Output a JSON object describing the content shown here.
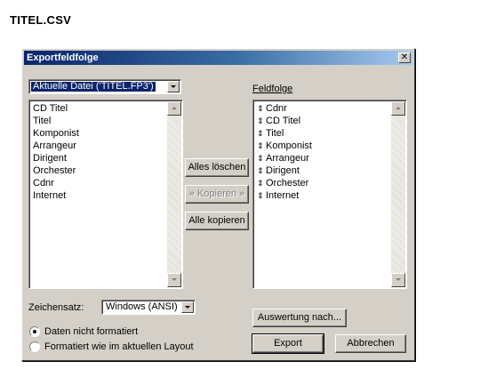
{
  "page": {
    "title": "TITEL.CSV"
  },
  "dialog": {
    "title": "Exportfeldfolge",
    "close_glyph": "✕",
    "source_select": {
      "value": "Aktuelle Datei ('TITEL.FP3')"
    },
    "source_fields": [
      "CD Titel",
      "Titel",
      "Komponist",
      "Arrangeur",
      "Dirigent",
      "Orchester",
      "Cdnr",
      "Internet"
    ],
    "buttons": {
      "clear_all": "Alles löschen",
      "copy": "» Kopieren »",
      "copy_all": "Alle kopieren",
      "evaluation": "Auswertung nach...",
      "export": "Export",
      "cancel": "Abbrechen"
    },
    "field_order": {
      "label": "Feldfolge",
      "move_glyph": "⇕",
      "items": [
        "Cdnr",
        "CD Titel",
        "Titel",
        "Komponist",
        "Arrangeur",
        "Dirigent",
        "Orchester",
        "Internet"
      ]
    },
    "charset": {
      "label": "Zeichensatz:",
      "value": "Windows (ANSI)"
    },
    "format_options": [
      {
        "label": "Daten nicht formatiert",
        "checked": true
      },
      {
        "label": "Formatiert wie im aktuellen Layout",
        "checked": false
      }
    ]
  }
}
